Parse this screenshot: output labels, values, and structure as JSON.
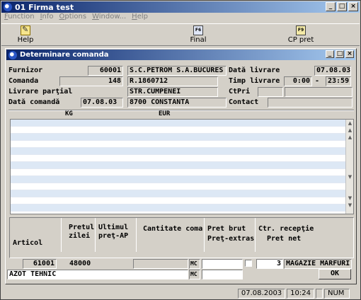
{
  "app": {
    "title": "01  Firma test"
  },
  "menu": [
    "Function",
    "Info",
    "Options",
    "Window...",
    "Help"
  ],
  "toolbar": {
    "help": "Help",
    "final": "Final",
    "cp_pret": "CP pret",
    "final_key": "F6",
    "cp_key": "F9"
  },
  "child": {
    "title": "Determinare comanda",
    "labels": {
      "furnizor": "Furnizor",
      "comanda": "Comanda",
      "livrare_partial": "Livrare parţial",
      "data_comanda": "Dată comandă",
      "data_livrare": "Dată livrare",
      "timp_livrare": "Timp livrare",
      "ctpri": "CtPri",
      "contact": "Contact",
      "kg": "KG",
      "eur": "EUR"
    },
    "values": {
      "furnizor": "60001",
      "comanda": "148",
      "data_comanda": "07.08.03",
      "data_livrare": "07.08.03",
      "timp_from": "0:00",
      "timp_sep": "-",
      "timp_to": "23:59",
      "supplier_name": "S.C.PETROM S.A.BUCURES",
      "supplier_reg": "R.1860712",
      "supplier_street": "STR.CUMPENEI",
      "supplier_city": "8700 CONSTANTA"
    },
    "columns": {
      "articol": "Articol",
      "pretul": "Pretul",
      "zilei": "zilei",
      "ultimul": "Ultimul",
      "pret_ap": "preţ-AP",
      "cantitate": "Cantitate coma",
      "pret_brut": "Pret brut",
      "pret_extras": "Preţ-extras",
      "ctr_receptie": "Ctr. recepţie",
      "pret_net": "Pret net"
    },
    "entry": {
      "articol": "61001",
      "pretul": "48000",
      "unit1": "MC",
      "unit2": "MC",
      "qty": "3",
      "magazie": "MAGAZIE MARFURI",
      "article_name": "AZOT TEHNIC",
      "ok": "OK"
    }
  },
  "status": {
    "date": "07.08.2003",
    "time": "10:24",
    "num": "NUM"
  }
}
